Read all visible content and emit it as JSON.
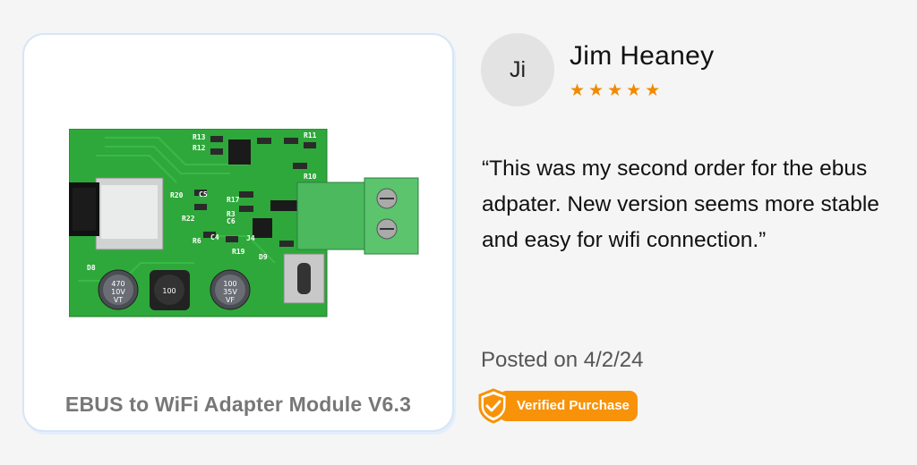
{
  "product": {
    "name": "EBUS to WiFi Adapter Module V6.3",
    "board_labels": {
      "c1": "R13",
      "c2": "R12",
      "c3": "R11",
      "c4": "R10",
      "c5": "R20",
      "c6": "R22",
      "c7": "C5",
      "c8": "R17",
      "c9": "R3",
      "c10": "C6",
      "c11": "R6",
      "c12": "C4",
      "c13": "R19",
      "c14": "J4",
      "c15": "D9",
      "c16": "D8",
      "cap1": "470",
      "cap1b": "10V",
      "cap1c": "VT",
      "ind": "100",
      "cap2": "100",
      "cap2b": "35V",
      "cap2c": "VF"
    }
  },
  "reviewer": {
    "initials": "Ji",
    "name": "Jim Heaney",
    "rating": 5
  },
  "review": {
    "text": "“This was my second order for the ebus adpater. New version seems more stable and easy for wifi connection.”",
    "posted": "Posted on 4/2/24",
    "badge": "Verified Purchase"
  },
  "colors": {
    "accent": "#f79209",
    "star": "#f08a00",
    "pcb": "#2ea83a"
  },
  "icons": {
    "star": "star-icon",
    "badge": "shield-check-icon"
  }
}
